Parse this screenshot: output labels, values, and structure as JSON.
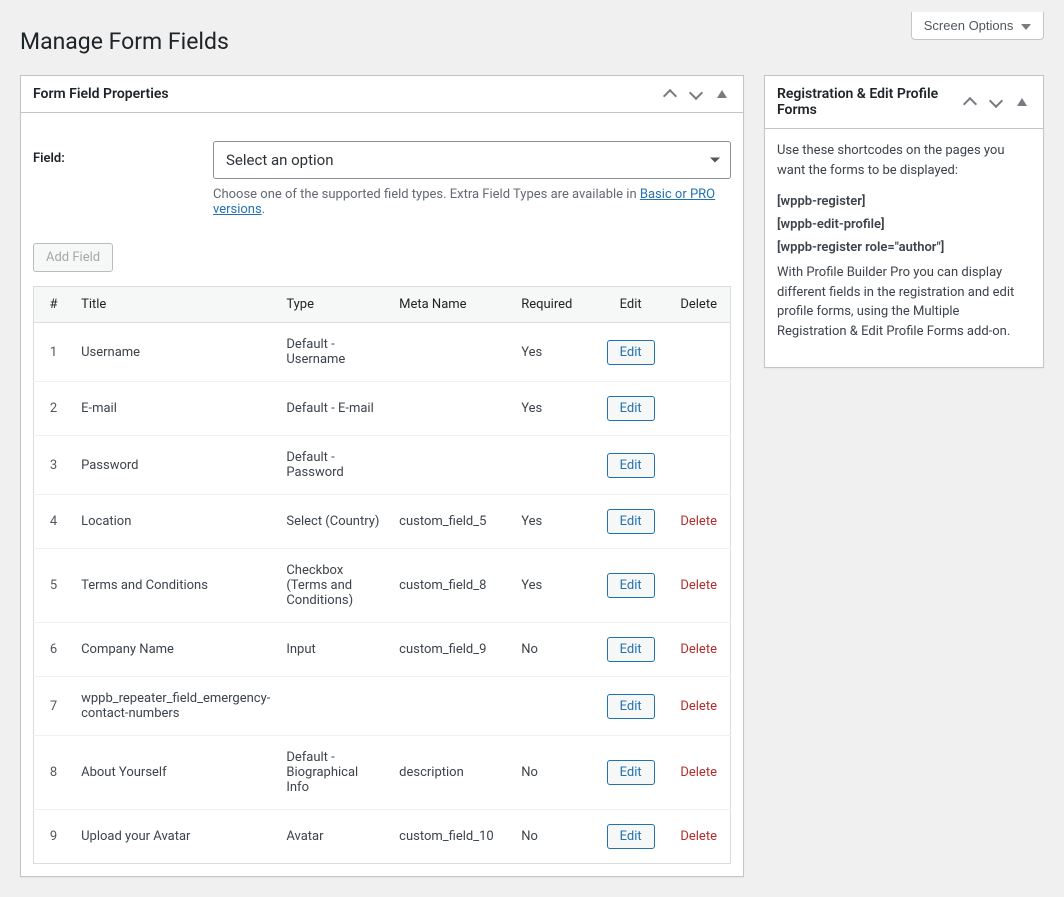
{
  "screen_options_label": "Screen Options",
  "page_title": "Manage Form Fields",
  "panel": {
    "title": "Form Field Properties",
    "field_label": "Field:",
    "select_placeholder": "Select an option",
    "description_prefix": "Choose one of the supported field types. Extra Field Types are available in ",
    "description_link": "Basic or PRO versions",
    "description_suffix": ".",
    "add_field_label": "Add Field"
  },
  "columns": {
    "num": "#",
    "title": "Title",
    "type": "Type",
    "meta": "Meta Name",
    "required": "Required",
    "edit": "Edit",
    "delete": "Delete"
  },
  "edit_label": "Edit",
  "delete_label": "Delete",
  "rows": [
    {
      "num": "1",
      "title": "Username",
      "type": "Default - Username",
      "meta": "",
      "required": "Yes",
      "deletable": false
    },
    {
      "num": "2",
      "title": "E-mail",
      "type": "Default - E-mail",
      "meta": "",
      "required": "Yes",
      "deletable": false
    },
    {
      "num": "3",
      "title": "Password",
      "type": "Default - Password",
      "meta": "",
      "required": "",
      "deletable": false
    },
    {
      "num": "4",
      "title": "Location",
      "type": "Select (Country)",
      "meta": "custom_field_5",
      "required": "Yes",
      "deletable": true
    },
    {
      "num": "5",
      "title": "Terms and Conditions",
      "type": "Checkbox (Terms and Conditions)",
      "meta": "custom_field_8",
      "required": "Yes",
      "deletable": true
    },
    {
      "num": "6",
      "title": "Company Name",
      "type": "Input",
      "meta": "custom_field_9",
      "required": "No",
      "deletable": true
    },
    {
      "num": "7",
      "title": "wppb_repeater_field_emergency-contact-numbers",
      "type": "",
      "meta": "",
      "required": "",
      "deletable": true
    },
    {
      "num": "8",
      "title": "About Yourself",
      "type": "Default - Biographical Info",
      "meta": "description",
      "required": "No",
      "deletable": true
    },
    {
      "num": "9",
      "title": "Upload your Avatar",
      "type": "Avatar",
      "meta": "custom_field_10",
      "required": "No",
      "deletable": true
    }
  ],
  "sidebar": {
    "title": "Registration & Edit Profile Forms",
    "intro": "Use these shortcodes on the pages you want the forms to be displayed:",
    "shortcodes": [
      "[wppb-register]",
      "[wppb-edit-profile]",
      "[wppb-register role=\"author\"]"
    ],
    "outro": "With Profile Builder Pro you can display different fields in the registration and edit profile forms, using the Multiple Registration & Edit Profile Forms add-on."
  }
}
